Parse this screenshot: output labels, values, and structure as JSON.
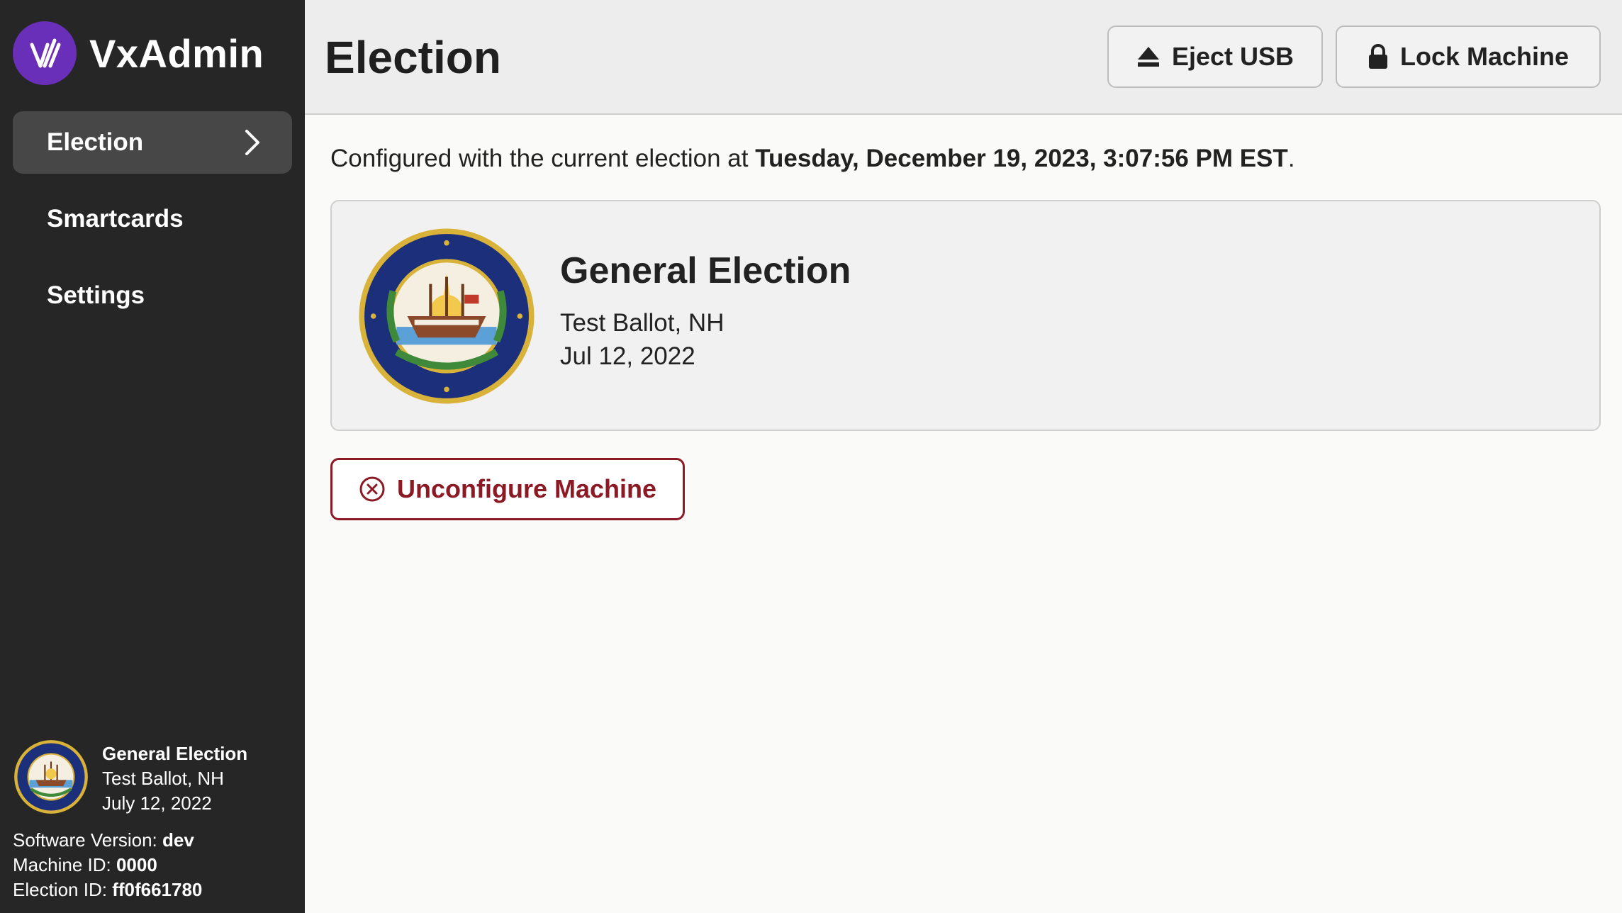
{
  "app": {
    "name": "VxAdmin",
    "logo_icon": "vx-logo-icon"
  },
  "sidebar": {
    "items": [
      {
        "label": "Election",
        "active": true
      },
      {
        "label": "Smartcards",
        "active": false
      },
      {
        "label": "Settings",
        "active": false
      }
    ],
    "footer": {
      "election_title": "General Election",
      "ballot_name": "Test Ballot, NH",
      "election_date": "July 12, 2022",
      "software_version_label": "Software Version:",
      "software_version_value": "dev",
      "machine_id_label": "Machine ID:",
      "machine_id_value": "0000",
      "election_id_label": "Election ID:",
      "election_id_value": "ff0f661780"
    }
  },
  "header": {
    "title": "Election",
    "eject_label": "Eject USB",
    "lock_label": "Lock Machine"
  },
  "main": {
    "configured_prefix": "Configured with the current election at ",
    "configured_timestamp": "Tuesday, December 19, 2023, 3:07:56 PM EST",
    "configured_suffix": ".",
    "card": {
      "title": "General Election",
      "ballot_name": "Test Ballot, NH",
      "date": "Jul 12, 2022"
    },
    "unconfigure_label": "Unconfigure Machine"
  },
  "colors": {
    "sidebar_bg": "#262626",
    "active_nav_bg": "#474747",
    "brand_purple": "#6a2fb8",
    "danger": "#8b1a24",
    "seal_blue": "#1c2f7a",
    "seal_gold": "#d9b23a"
  }
}
